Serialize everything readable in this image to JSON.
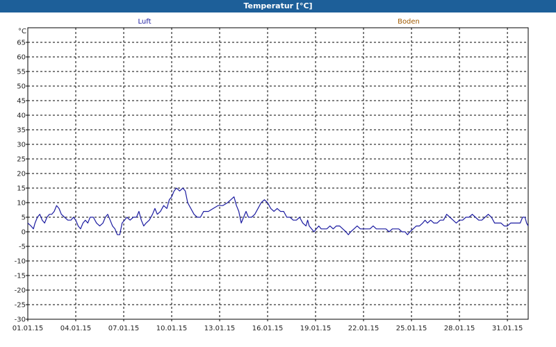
{
  "window": {
    "title": "Temperatur [°C]"
  },
  "colors": {
    "luft": "#1a1aa0",
    "boden": "#a05a00",
    "titlebar": "#1d5f99",
    "grid": "#000000"
  },
  "chart_data": {
    "type": "line",
    "title": "Temperatur [°C]",
    "ylabel": "°C",
    "xlabel": "",
    "ylim": [
      -30,
      70
    ],
    "xlim": [
      1,
      32.3
    ],
    "y_ticks": [
      65,
      60,
      55,
      50,
      45,
      40,
      35,
      30,
      25,
      20,
      15,
      10,
      5,
      0,
      -5,
      -10,
      -15,
      -20,
      -25,
      -30
    ],
    "x_ticks": [
      {
        "day": 1,
        "label": "01.01.15"
      },
      {
        "day": 4,
        "label": "04.01.15"
      },
      {
        "day": 7,
        "label": "07.01.15"
      },
      {
        "day": 10,
        "label": "10.01.15"
      },
      {
        "day": 13,
        "label": "13.01.15"
      },
      {
        "day": 16,
        "label": "16.01.15"
      },
      {
        "day": 19,
        "label": "19.01.15"
      },
      {
        "day": 22,
        "label": "22.01.15"
      },
      {
        "day": 25,
        "label": "25.01.15"
      },
      {
        "day": 28,
        "label": "28.01.15"
      },
      {
        "day": 31,
        "label": "31.01.15"
      }
    ],
    "grid": true,
    "series": [
      {
        "name": "Luft",
        "color": "#1a1aa0",
        "points": [
          [
            1.0,
            3
          ],
          [
            1.2,
            2
          ],
          [
            1.35,
            1
          ],
          [
            1.45,
            3
          ],
          [
            1.6,
            5
          ],
          [
            1.75,
            6
          ],
          [
            1.9,
            4
          ],
          [
            2.05,
            3
          ],
          [
            2.2,
            5
          ],
          [
            2.35,
            6
          ],
          [
            2.5,
            6
          ],
          [
            2.65,
            7
          ],
          [
            2.8,
            9
          ],
          [
            2.95,
            8
          ],
          [
            3.1,
            6
          ],
          [
            3.3,
            5
          ],
          [
            3.5,
            4
          ],
          [
            3.7,
            4
          ],
          [
            3.85,
            5
          ],
          [
            4.0,
            4
          ],
          [
            4.15,
            2
          ],
          [
            4.3,
            1
          ],
          [
            4.45,
            3
          ],
          [
            4.6,
            4
          ],
          [
            4.75,
            3
          ],
          [
            4.9,
            5
          ],
          [
            5.1,
            5
          ],
          [
            5.3,
            3
          ],
          [
            5.5,
            2
          ],
          [
            5.7,
            3
          ],
          [
            5.85,
            5
          ],
          [
            6.0,
            6
          ],
          [
            6.15,
            4
          ],
          [
            6.3,
            2
          ],
          [
            6.45,
            1
          ],
          [
            6.6,
            -1
          ],
          [
            6.75,
            -1
          ],
          [
            6.9,
            3
          ],
          [
            7.05,
            4
          ],
          [
            7.2,
            5
          ],
          [
            7.4,
            4
          ],
          [
            7.6,
            5
          ],
          [
            7.8,
            5
          ],
          [
            7.95,
            7
          ],
          [
            8.1,
            4
          ],
          [
            8.25,
            2
          ],
          [
            8.4,
            3
          ],
          [
            8.6,
            4
          ],
          [
            8.8,
            6
          ],
          [
            8.95,
            8
          ],
          [
            9.1,
            6
          ],
          [
            9.3,
            7
          ],
          [
            9.5,
            9
          ],
          [
            9.7,
            8
          ],
          [
            9.85,
            11
          ],
          [
            10.0,
            12
          ],
          [
            10.15,
            14
          ],
          [
            10.3,
            15
          ],
          [
            10.5,
            14
          ],
          [
            10.7,
            15
          ],
          [
            10.85,
            14
          ],
          [
            11.0,
            10
          ],
          [
            11.2,
            8
          ],
          [
            11.4,
            6
          ],
          [
            11.6,
            5
          ],
          [
            11.8,
            5
          ],
          [
            12.0,
            7
          ],
          [
            12.3,
            7
          ],
          [
            12.6,
            8
          ],
          [
            12.9,
            9
          ],
          [
            13.2,
            9
          ],
          [
            13.5,
            10
          ],
          [
            13.7,
            11
          ],
          [
            13.9,
            12
          ],
          [
            14.05,
            9
          ],
          [
            14.2,
            7
          ],
          [
            14.35,
            3
          ],
          [
            14.5,
            5
          ],
          [
            14.65,
            7
          ],
          [
            14.8,
            5
          ],
          [
            15.0,
            5
          ],
          [
            15.2,
            6
          ],
          [
            15.4,
            8
          ],
          [
            15.6,
            10
          ],
          [
            15.8,
            11
          ],
          [
            16.0,
            10
          ],
          [
            16.2,
            8
          ],
          [
            16.4,
            7
          ],
          [
            16.6,
            8
          ],
          [
            16.8,
            7
          ],
          [
            17.0,
            7
          ],
          [
            17.2,
            5
          ],
          [
            17.4,
            5
          ],
          [
            17.6,
            4
          ],
          [
            17.8,
            4
          ],
          [
            18.0,
            5
          ],
          [
            18.2,
            3
          ],
          [
            18.4,
            2
          ],
          [
            18.5,
            4
          ],
          [
            18.6,
            2
          ],
          [
            18.75,
            1
          ],
          [
            18.9,
            0
          ],
          [
            19.05,
            1
          ],
          [
            19.2,
            2
          ],
          [
            19.35,
            1
          ],
          [
            19.5,
            1
          ],
          [
            19.7,
            1
          ],
          [
            19.9,
            2
          ],
          [
            20.1,
            1
          ],
          [
            20.3,
            2
          ],
          [
            20.5,
            2
          ],
          [
            20.7,
            1
          ],
          [
            20.9,
            0
          ],
          [
            21.05,
            -1
          ],
          [
            21.2,
            0
          ],
          [
            21.4,
            1
          ],
          [
            21.6,
            2
          ],
          [
            21.8,
            1
          ],
          [
            22.0,
            1
          ],
          [
            22.2,
            1
          ],
          [
            22.4,
            1
          ],
          [
            22.6,
            2
          ],
          [
            22.8,
            1
          ],
          [
            23.0,
            1
          ],
          [
            23.2,
            1
          ],
          [
            23.4,
            1
          ],
          [
            23.6,
            0
          ],
          [
            23.8,
            1
          ],
          [
            24.0,
            1
          ],
          [
            24.2,
            1
          ],
          [
            24.4,
            0
          ],
          [
            24.6,
            0
          ],
          [
            24.75,
            -1
          ],
          [
            24.9,
            0
          ],
          [
            25.1,
            1
          ],
          [
            25.3,
            2
          ],
          [
            25.5,
            2
          ],
          [
            25.7,
            3
          ],
          [
            25.85,
            4
          ],
          [
            26.0,
            3
          ],
          [
            26.2,
            4
          ],
          [
            26.4,
            3
          ],
          [
            26.6,
            3
          ],
          [
            26.8,
            4
          ],
          [
            27.0,
            4
          ],
          [
            27.2,
            6
          ],
          [
            27.4,
            5
          ],
          [
            27.6,
            4
          ],
          [
            27.8,
            3
          ],
          [
            28.0,
            4
          ],
          [
            28.2,
            4
          ],
          [
            28.4,
            5
          ],
          [
            28.6,
            5
          ],
          [
            28.8,
            6
          ],
          [
            29.0,
            5
          ],
          [
            29.2,
            4
          ],
          [
            29.4,
            4
          ],
          [
            29.6,
            5
          ],
          [
            29.8,
            6
          ],
          [
            30.0,
            5
          ],
          [
            30.2,
            3
          ],
          [
            30.4,
            3
          ],
          [
            30.6,
            3
          ],
          [
            30.8,
            2
          ],
          [
            31.0,
            2
          ],
          [
            31.2,
            3
          ],
          [
            31.4,
            3
          ],
          [
            31.6,
            3
          ],
          [
            31.8,
            3
          ],
          [
            31.95,
            5
          ],
          [
            32.1,
            5
          ],
          [
            32.2,
            3
          ],
          [
            32.3,
            2
          ]
        ]
      },
      {
        "name": "Boden",
        "color": "#a05a00",
        "points": []
      }
    ]
  }
}
